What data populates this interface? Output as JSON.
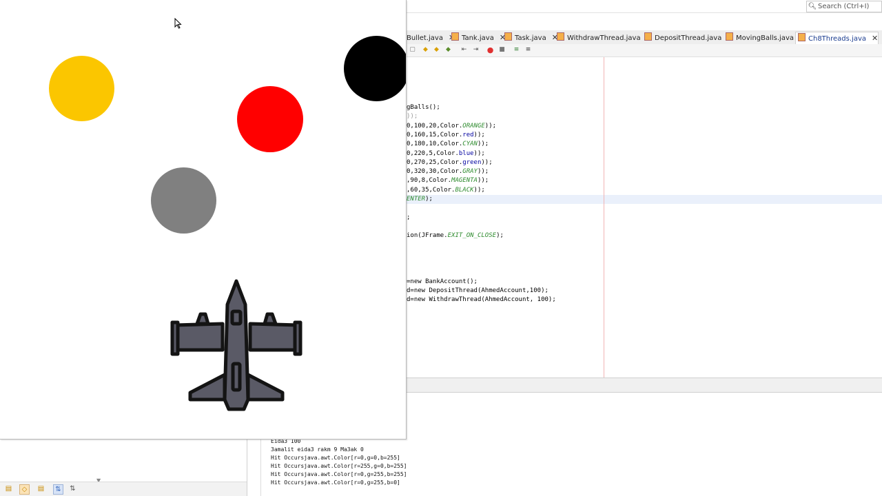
{
  "search": {
    "placeholder": "Search (Ctrl+I)"
  },
  "tabs": [
    {
      "label": "Bullet.java",
      "active": false
    },
    {
      "label": "Tank.java",
      "active": false
    },
    {
      "label": "Task.java",
      "active": false
    },
    {
      "label": "WithdrawThread.java",
      "active": false
    },
    {
      "label": "DepositThread.java",
      "active": false
    },
    {
      "label": "MovingBalls.java",
      "active": false
    },
    {
      "label": "Ch8Threads.java",
      "active": true
    }
  ],
  "code_lines": [
    {
      "a": "gBalls();",
      "b": "",
      "c": ""
    },
    {
      "a": "",
      "b": "",
      "c": "));"
    },
    {
      "a": "0,100,20,Color.",
      "b": "ORANGE",
      "c": "));"
    },
    {
      "a": "0,160,15,Color.",
      "b": "red",
      "c": "));"
    },
    {
      "a": "0,180,10,Color.",
      "b": "CYAN",
      "c": "));"
    },
    {
      "a": "0,220,5,Color.",
      "b": "blue",
      "c": "));"
    },
    {
      "a": "0,270,25,Color.",
      "b": "green",
      "c": "));"
    },
    {
      "a": "0,320,30,Color.",
      "b": "GRAY",
      "c": "));"
    },
    {
      "a": ",90,8,Color.",
      "b": "MAGENTA",
      "c": "));"
    },
    {
      "a": ",60,35,Color.",
      "b": "BLACK",
      "c": "));"
    },
    {
      "a": "",
      "b": "ENTER",
      "c": ");"
    },
    {
      "a": ";",
      "b": "",
      "c": ""
    },
    {
      "a": "ion(JFrame.",
      "b": "EXIT_ON_CLOSE",
      "c": ");"
    },
    {
      "a": "=new BankAccount();",
      "b": "",
      "c": ""
    },
    {
      "a": "d=new DepositThread(AhmedAccount,100);",
      "b": "",
      "c": ""
    },
    {
      "a": "d=new WithdrawThread(AhmedAccount, 100);",
      "b": "",
      "c": ""
    }
  ],
  "output_lines": [
    "Eida3 100",
    "3amalit eida3 rakm 9 Ma3ak 0",
    "Hit Occursjava.awt.Color[r=0,g=0,b=255]",
    "Hit Occursjava.awt.Color[r=255,g=0,b=255]",
    "Hit Occursjava.awt.Color[r=0,g=255,b=255]",
    "Hit Occursjava.awt.Color[r=0,g=255,b=0]"
  ],
  "balls": [
    {
      "name": "yellow",
      "color": "#FBC600"
    },
    {
      "name": "red",
      "color": "#FF0000"
    },
    {
      "name": "black",
      "color": "#000000"
    },
    {
      "name": "gray",
      "color": "#808080"
    }
  ],
  "icons": {
    "search": "search-icon",
    "cursor": "mouse-cursor-icon",
    "plane": "fighter-jet-icon"
  },
  "colors": {
    "plane_body": "#5a5a66",
    "plane_outline": "#141414"
  }
}
